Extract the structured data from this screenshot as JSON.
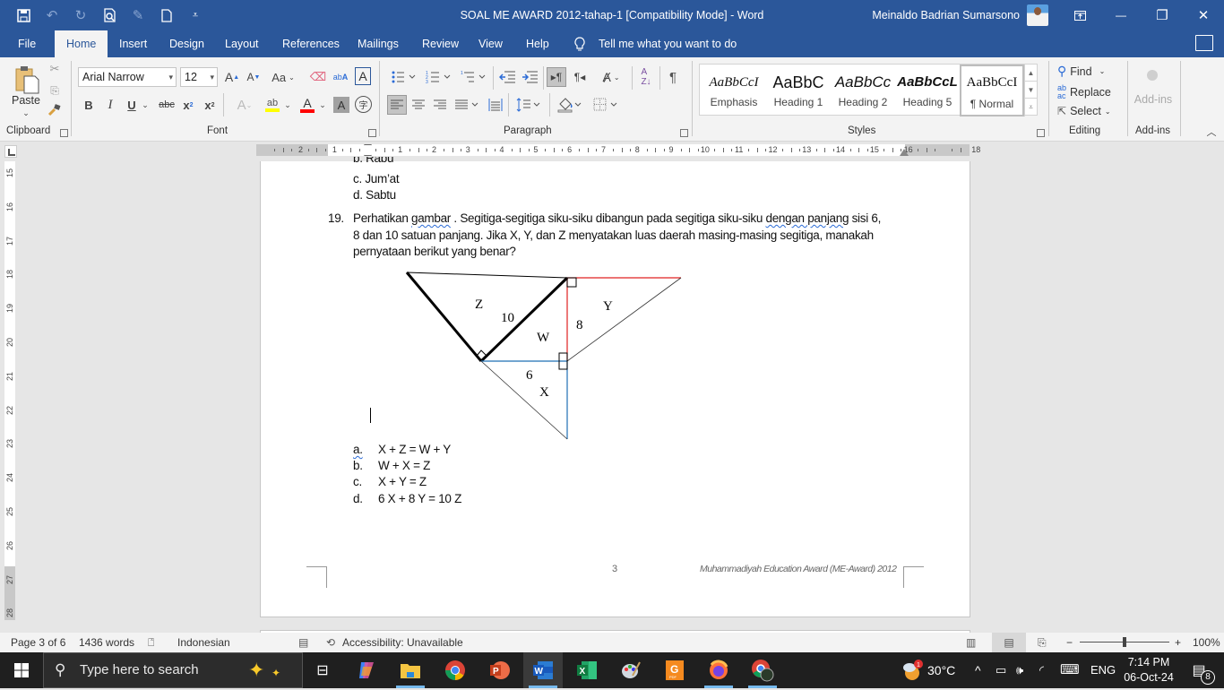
{
  "window": {
    "title": "SOAL ME AWARD 2012-tahap-1 [Compatibility Mode]  -  Word",
    "user_name": "Meinaldo Badrian Sumarsono",
    "quick_access": [
      "save-icon",
      "undo-icon",
      "redo-icon",
      "print-preview-icon",
      "touch-mode-icon",
      "new-document-icon",
      "customize-qat-icon"
    ],
    "controls": {
      "ribbon_display": "⊡",
      "minimize": "—",
      "restore": "❐",
      "close": "✕"
    }
  },
  "menu": {
    "tabs": [
      "File",
      "Home",
      "Insert",
      "Design",
      "Layout",
      "References",
      "Mailings",
      "Review",
      "View",
      "Help"
    ],
    "active_tab": "Home",
    "tell_me": "Tell me what you want to do"
  },
  "ribbon": {
    "clipboard": {
      "label": "Clipboard",
      "paste": "Paste"
    },
    "font": {
      "label": "Font",
      "font_name": "Arial Narrow",
      "font_size": "12",
      "highlight_color": "#ffff00",
      "font_color": "#ff0000"
    },
    "paragraph": {
      "label": "Paragraph"
    },
    "styles": {
      "label": "Styles",
      "items": [
        {
          "preview": "AaBbCcI",
          "name": "Emphasis"
        },
        {
          "preview": "AaBbC",
          "name": "Heading 1"
        },
        {
          "preview": "AaBbCc",
          "name": "Heading 2"
        },
        {
          "preview": "AaBbCcL",
          "name": "Heading 5"
        },
        {
          "preview": "AaBbCcI",
          "name": "¶ Normal"
        }
      ],
      "selected": "¶ Normal"
    },
    "editing": {
      "label": "Editing",
      "find": "Find",
      "replace": "Replace",
      "select": "Select"
    },
    "addins": {
      "label": "Add-ins",
      "button": "Add-ins"
    }
  },
  "rulers": {
    "horizontal": [
      "2",
      "1",
      "1",
      "2",
      "3",
      "4",
      "5",
      "6",
      "7",
      "8",
      "9",
      "10",
      "11",
      "12",
      "13",
      "14",
      "15",
      "16",
      "18"
    ],
    "vertical": [
      "15",
      "16",
      "17",
      "18",
      "19",
      "20",
      "21",
      "22",
      "23",
      "24",
      "25",
      "26",
      "27",
      "28"
    ]
  },
  "document": {
    "prev_options": [
      "b. Rabu",
      "c.  Jum’at",
      "d. Sabtu"
    ],
    "question": {
      "number": "19.",
      "line1_a": "Perhatikan ",
      "line1_b": "gambar",
      "line1_c": " . Segitiga-segitiga siku-siku dibangun pada segitiga siku-siku ",
      "line1_d": "dengan  panjang",
      "line1_e": " sisi 6,",
      "line2": "8 dan 10 satuan panjang. Jika X, Y, dan Z menyatakan luas daerah masing-masing segitiga, manakah",
      "line3": "pernyataan berikut yang benar?"
    },
    "figure": {
      "labels": {
        "z": "Z",
        "ten": "10",
        "w": "W",
        "eight": "8",
        "y": "Y",
        "six": "6",
        "x": "X"
      },
      "colors": {
        "thick": "#000000",
        "red": "#e02020",
        "blue": "#1f6fb5",
        "thin": "#333333"
      }
    },
    "options": [
      {
        "letter": "a.",
        "text": "X + Z = W + Y"
      },
      {
        "letter": "b.",
        "text": "W + X = Z"
      },
      {
        "letter": "c.",
        "text": "X + Y = Z"
      },
      {
        "letter": "d.",
        "text": "6 X + 8 Y = 10 Z"
      }
    ],
    "footer": {
      "page_number": "3",
      "text": "Muhammadiyah Education Award (ME-Award) 2012"
    }
  },
  "status": {
    "page": "Page 3 of 6",
    "words": "1436 words",
    "language": "Indonesian",
    "accessibility": "Accessibility: Unavailable",
    "zoom": "100%",
    "zoom_minus": "−",
    "zoom_plus": "+"
  },
  "taskbar": {
    "search_placeholder": "Type here to search",
    "apps": [
      "task-view",
      "copilot",
      "file-explorer",
      "chrome",
      "powerpoint",
      "word",
      "excel",
      "paint",
      "foxit-pdf",
      "firefox",
      "chrome-profile"
    ],
    "active_app": "word",
    "weather": "30°C",
    "weather_badge": "1",
    "language": "ENG",
    "time": "7:14 PM",
    "date": "06-Oct-24",
    "notifications": "8"
  }
}
